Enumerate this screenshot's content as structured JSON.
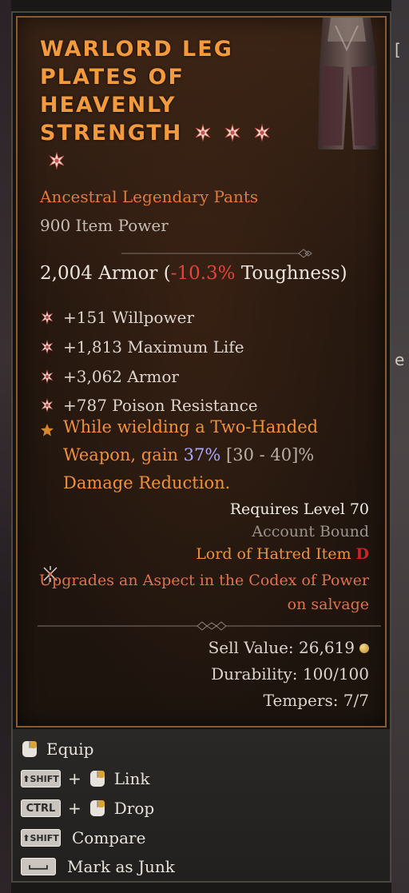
{
  "item": {
    "name_lines": [
      "WARLORD LEG",
      "PLATES OF",
      "HEAVENLY",
      "STRENGTH"
    ],
    "type": "Ancestral Legendary Pants",
    "item_power": "900 Item Power",
    "armor": {
      "value": "2,004 Armor (",
      "toughness_delta": "-10.3%",
      "suffix": " Toughness)"
    },
    "affixes": [
      "+151 Willpower",
      "+1,813 Maximum Life",
      "+3,062 Armor",
      "+787 Poison Resistance"
    ],
    "legendary_power": {
      "line1": "While wielding a Two-Handed",
      "line2_prefix": "Weapon, gain ",
      "value": "37%",
      "range": " [30 - 40]%",
      "line3": "Damage Reduction."
    },
    "requires_level": "Requires Level 70",
    "account_bound": "Account Bound",
    "expansion_item": "Lord of Hatred Item",
    "expansion_badge": "D",
    "codex_line1": "Upgrades an Aspect in the Codex of Power",
    "codex_line2": "on salvage",
    "sell_value": "Sell Value: 26,619",
    "durability": "Durability: 100/100",
    "tempers": "Tempers: 7/7"
  },
  "controls": {
    "equip": "Equip",
    "link": "Link",
    "drop": "Drop",
    "compare": "Compare",
    "mark_junk": "Mark as Junk",
    "shift_key": "SHIFT",
    "ctrl_key": "CTRL",
    "plus": "+"
  },
  "right_edge_glyphs": [
    "[",
    "e"
  ],
  "colors": {
    "legendary_orange": "#f29a3c",
    "negative_red": "#e2453a",
    "value_blue": "#a9a9ff",
    "card_border": "#8a5a30"
  }
}
